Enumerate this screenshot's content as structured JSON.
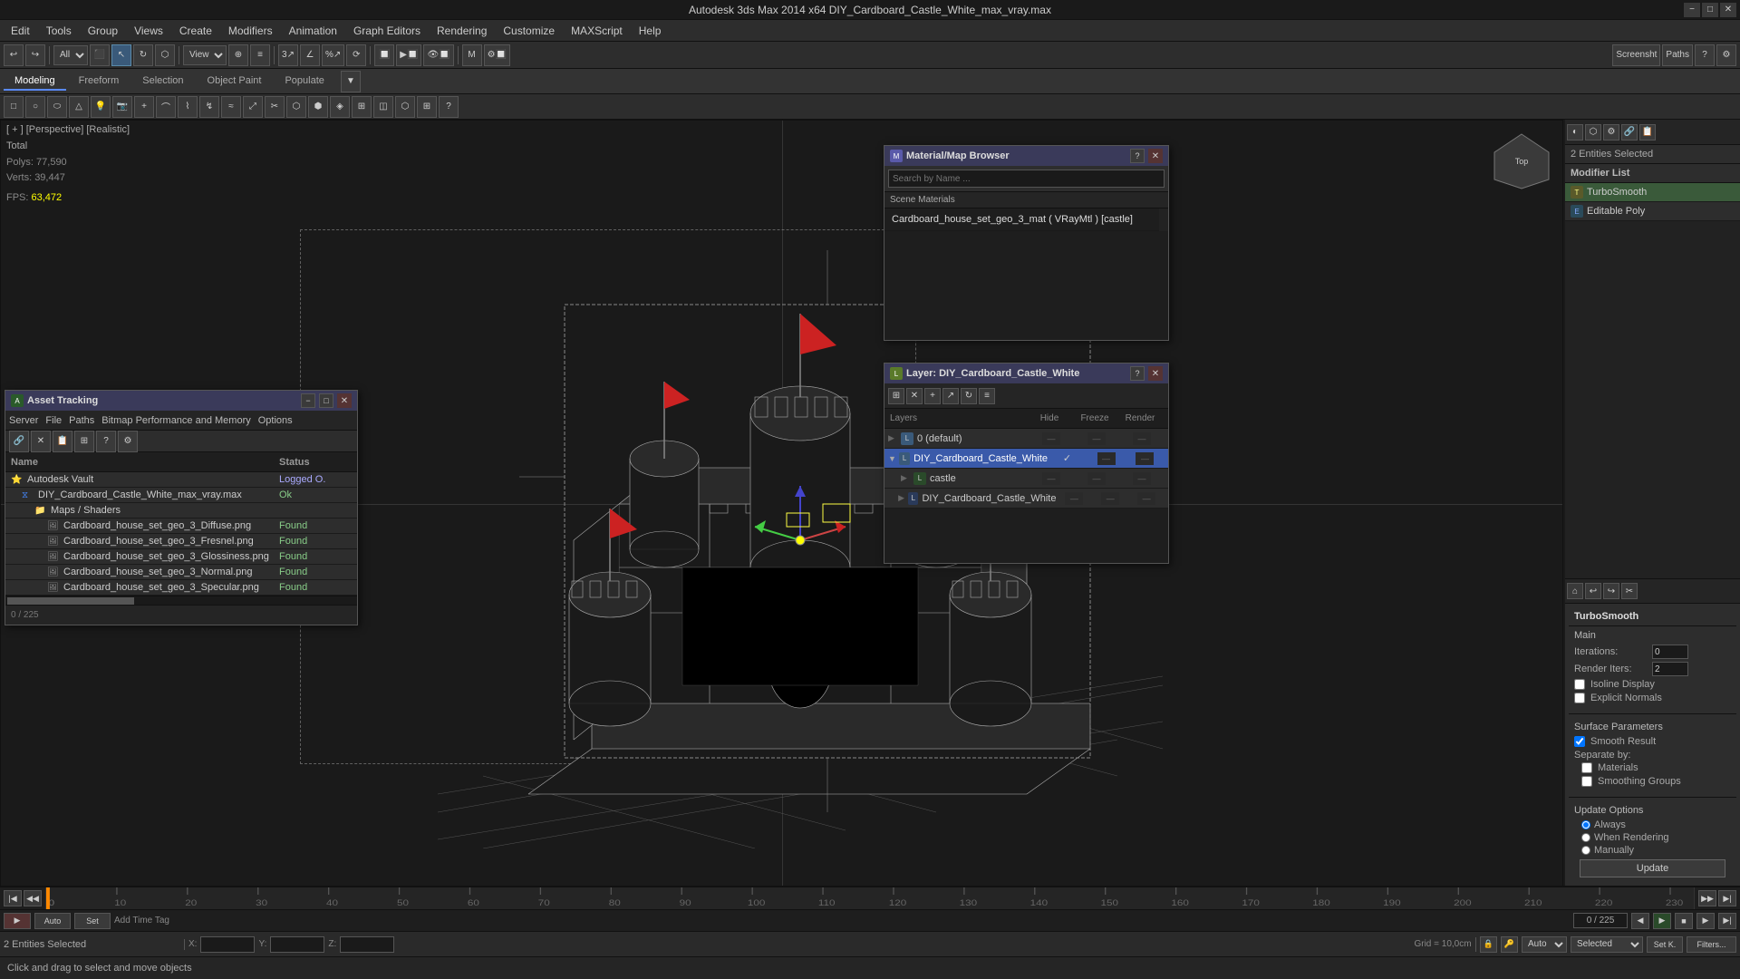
{
  "titlebar": {
    "title": "Autodesk 3ds Max 2014 x64    DIY_Cardboard_Castle_White_max_vray.max",
    "minimize": "−",
    "maximize": "□",
    "close": "✕"
  },
  "menubar": {
    "items": [
      "Edit",
      "Tools",
      "Group",
      "Views",
      "Create",
      "Modifiers",
      "Animation",
      "Graph Editors",
      "Rendering",
      "Customize",
      "MAXScript",
      "Help"
    ]
  },
  "toolbar1": {
    "mode_select": "All",
    "screensht": "Screensht",
    "paths": "Paths",
    "view_select": "View"
  },
  "toolbar2": {
    "tabs": [
      "Modeling",
      "Freeform",
      "Selection",
      "Object Paint",
      "Populate"
    ]
  },
  "viewport": {
    "label": "[ + ] [Perspective] [Realistic]",
    "stats": {
      "total_label": "Total",
      "polys_label": "Polys:",
      "polys_val": "77,590",
      "verts_label": "Verts:",
      "verts_val": "39,447",
      "fps_label": "FPS:",
      "fps_val": "63,472"
    }
  },
  "right_panel": {
    "entities_selected": "2 Entities Selected",
    "modifier_list_label": "Modifier List",
    "modifiers": [
      {
        "name": "TurboSmooth",
        "icon": "T"
      },
      {
        "name": "Editable Poly",
        "icon": "E"
      }
    ],
    "turbosmooth": {
      "title": "TurboSmooth",
      "main_label": "Main",
      "iterations_label": "Iterations:",
      "iterations_val": "0",
      "render_iters_label": "Render Iters:",
      "render_iters_val": "2",
      "isoline_label": "Isoline Display",
      "explicit_normals_label": "Explicit Normals",
      "surface_params_label": "Surface Parameters",
      "smooth_result_label": "Smooth Result",
      "separate_by_label": "Separate by:",
      "materials_label": "Materials",
      "smoothing_groups_label": "Smoothing Groups",
      "update_options_label": "Update Options",
      "always_label": "Always",
      "when_rendering_label": "When Rendering",
      "manually_label": "Manually",
      "update_btn": "Update"
    }
  },
  "material_browser": {
    "title": "Material/Map Browser",
    "search_placeholder": "Search by Name ...",
    "scene_materials_label": "Scene Materials",
    "mat_item": "Cardboard_house_set_geo_3_mat ( VRayMtl ) [castle]"
  },
  "layer_manager": {
    "title": "Layer: DIY_Cardboard_Castle_White",
    "header": {
      "name_label": "Layers",
      "hide_label": "Hide",
      "freeze_label": "Freeze",
      "render_label": "Render"
    },
    "layers": [
      {
        "indent": 0,
        "name": "0 (default)",
        "selected": false
      },
      {
        "indent": 0,
        "name": "DIY_Cardboard_Castle_White",
        "selected": true
      },
      {
        "indent": 1,
        "name": "castle",
        "selected": false
      },
      {
        "indent": 1,
        "name": "DIY_Cardboard_Castle_White",
        "selected": false
      }
    ]
  },
  "asset_tracking": {
    "title": "Asset Tracking",
    "menu_items": [
      "Server",
      "File",
      "Paths",
      "Bitmap Performance and Memory",
      "Options"
    ],
    "columns": [
      "Name",
      "Status"
    ],
    "rows": [
      {
        "indent": 0,
        "icon": "vault",
        "name": "Autodesk Vault",
        "status": "Logged O.",
        "status_class": "status-logged"
      },
      {
        "indent": 1,
        "icon": "file",
        "name": "DIY_Cardboard_Castle_White_max_vray.max",
        "status": "Ok",
        "status_class": "status-ok"
      },
      {
        "indent": 2,
        "icon": "folder",
        "name": "Maps / Shaders",
        "status": "",
        "status_class": ""
      },
      {
        "indent": 3,
        "icon": "img",
        "name": "Cardboard_house_set_geo_3_Diffuse.png",
        "status": "Found",
        "status_class": "status-found"
      },
      {
        "indent": 3,
        "icon": "img",
        "name": "Cardboard_house_set_geo_3_Fresnel.png",
        "status": "Found",
        "status_class": "status-found"
      },
      {
        "indent": 3,
        "icon": "img",
        "name": "Cardboard_house_set_geo_3_Glossiness.png",
        "status": "Found",
        "status_class": "status-found"
      },
      {
        "indent": 3,
        "icon": "img",
        "name": "Cardboard_house_set_geo_3_Normal.png",
        "status": "Found",
        "status_class": "status-found"
      },
      {
        "indent": 3,
        "icon": "img",
        "name": "Cardboard_house_set_geo_3_Specular.png",
        "status": "Found",
        "status_class": "status-found"
      }
    ],
    "frame_text": "0 / 225"
  },
  "status_bar": {
    "entities_label": "2 Entities Selected",
    "instruction": "Click and drag to select and move objects",
    "grid_label": "Grid = 10,0cm",
    "auto_label": "Auto",
    "selected_label": "Selected",
    "set_k_label": "Set K.",
    "filters_label": "Filters..."
  },
  "timeline": {
    "frame_current": "0",
    "frame_end": "225",
    "ticks": [
      0,
      10,
      20,
      30,
      40,
      50,
      60,
      70,
      80,
      90,
      100,
      110,
      120,
      130,
      140,
      150,
      160,
      170,
      180,
      190,
      200,
      210,
      220,
      230
    ],
    "add_time_tag": "Add Time Tag"
  },
  "icons": {
    "minimize": "−",
    "maximize": "□",
    "restore": "❐",
    "close": "✕",
    "lock": "🔒",
    "key": "🔑",
    "search": "🔍",
    "folder": "📁",
    "file": "📄",
    "image": "🖼",
    "arrow_right": "▶",
    "arrow_left": "◀",
    "arrow_up": "▲",
    "arrow_down": "▼",
    "play": "▶",
    "stop": "■",
    "record": "⏺",
    "link": "🔗",
    "check": "✓",
    "cross": "✕",
    "plus": "+",
    "minus": "−",
    "gear": "⚙",
    "question": "?",
    "pin": "📌",
    "camera": "📷"
  }
}
